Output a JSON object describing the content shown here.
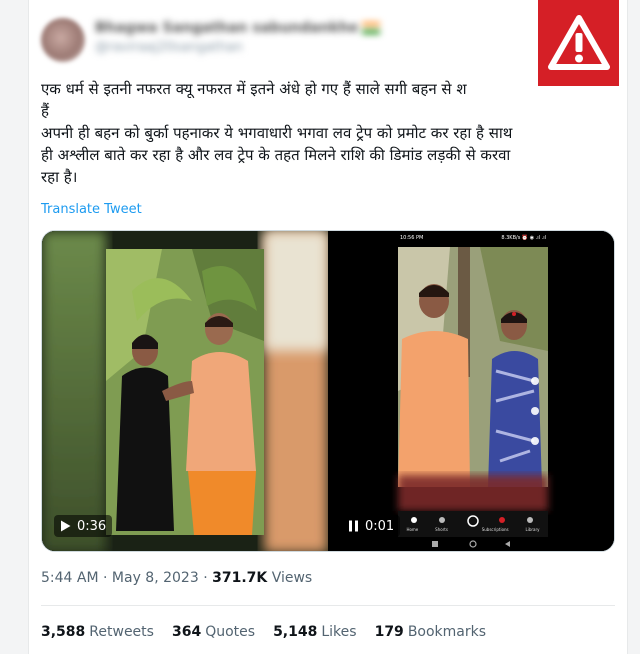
{
  "user": {
    "display_name": "Bhagwa Sangathan sabundankhe",
    "handle": "@raviraaj20sangathan"
  },
  "tweet": {
    "line1": "एक धर्म से इतनी नफरत क्यू नफरत में इतने अंधे हो गए हैं साले सगी बहन से श",
    "line2": "हैं",
    "line3": "अपनी ही बहन को बुर्का पहनाकर ये भगवाधारी  भगवा लव ट्रेप को प्रमोट कर रहा है साथ",
    "line4": "ही अश्लील बाते कर रहा है और लव ट्रेप के तहत मिलने राशि की डिमांड लड़की से करवा",
    "line5": "रहा है।",
    "translate_label": "Translate Tweet"
  },
  "media": {
    "video1": {
      "duration": "0:36",
      "control_icon": "play-icon"
    },
    "video2": {
      "duration": "0:01",
      "control_icon": "pause-icon",
      "phone_status_time": "10:56 PM",
      "phone_status_info": "8.3KB/s ⏰ ◉ .ıl .ıl",
      "phone_nav": [
        "Home",
        "Shorts",
        "",
        "Subscriptions",
        "Library"
      ]
    }
  },
  "meta": {
    "time": "5:44 AM",
    "separator": "·",
    "date": "May 8, 2023",
    "views_count": "371.7K",
    "views_label": "Views"
  },
  "stats": {
    "retweets_count": "3,588",
    "retweets_label": "Retweets",
    "quotes_count": "364",
    "quotes_label": "Quotes",
    "likes_count": "5,148",
    "likes_label": "Likes",
    "bookmarks_count": "179",
    "bookmarks_label": "Bookmarks"
  },
  "colors": {
    "warning_red": "#d51f26",
    "link_blue": "#1d9bf0",
    "muted_gray": "#536471",
    "saffron": "#f5a66a"
  }
}
